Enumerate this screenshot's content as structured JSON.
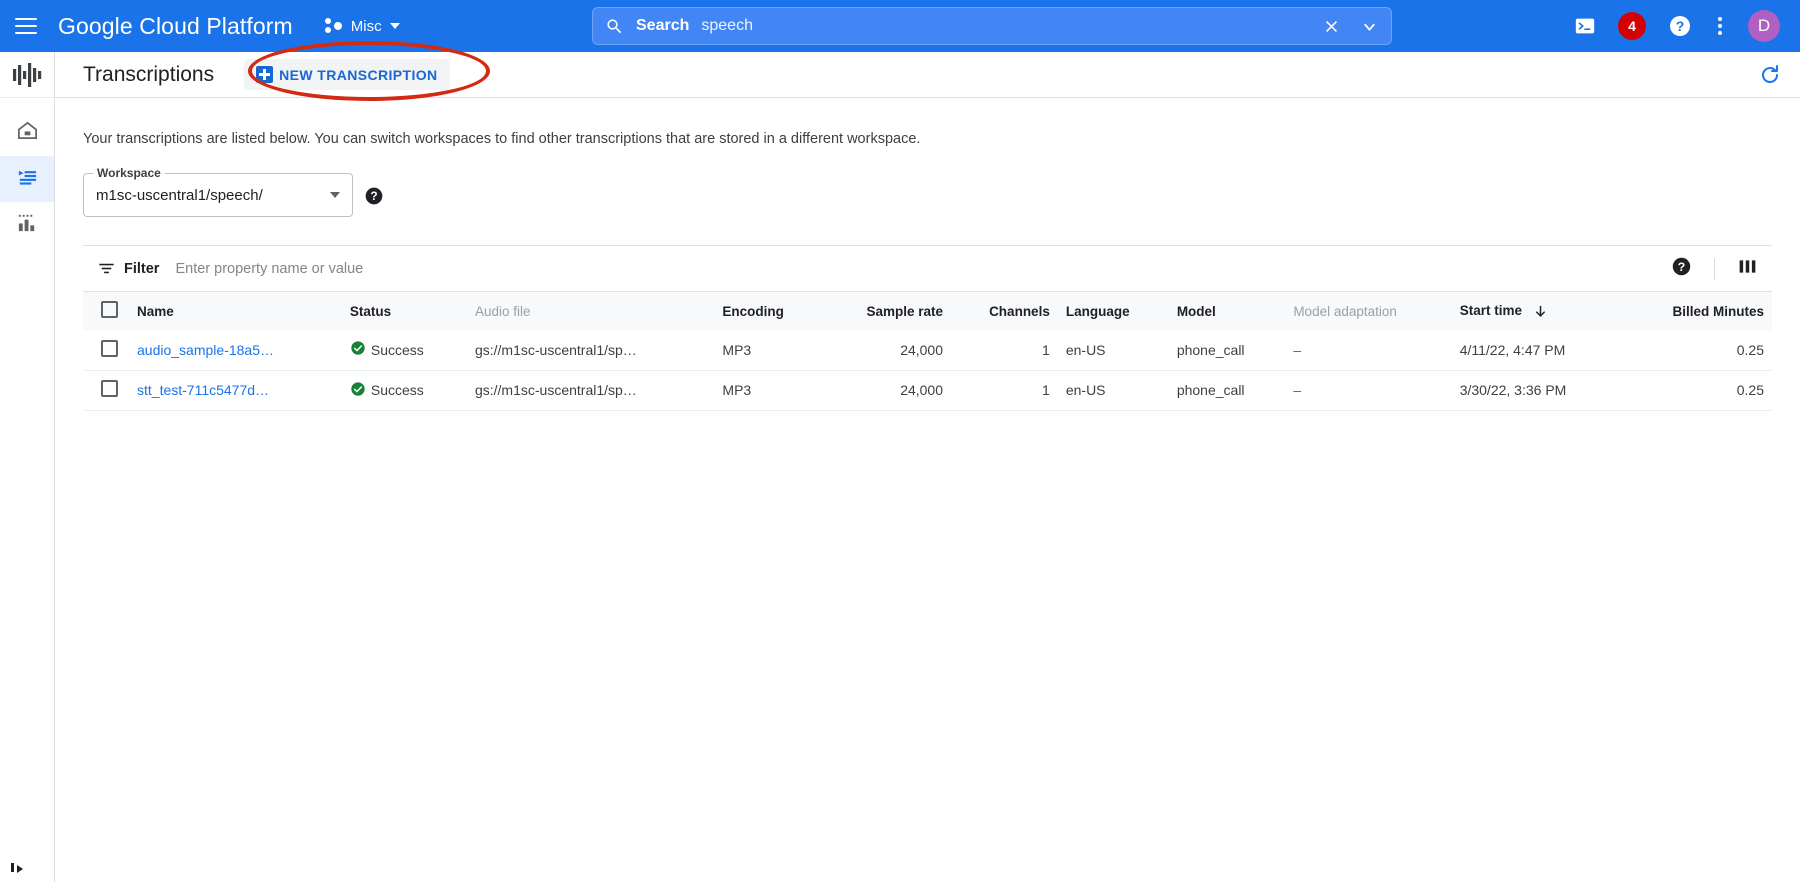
{
  "topbar": {
    "menu_icon": "hamburger-icon",
    "brand": "Google Cloud Platform",
    "project": "Misc",
    "search": {
      "label": "Search",
      "value": "speech",
      "clear_icon": "close-icon",
      "expand_icon": "chevron-down-icon"
    },
    "cloud_shell_icon": "terminal-icon",
    "notification_count": "4",
    "help_icon": "help-icon",
    "more_icon": "kebab-menu-icon",
    "avatar_initial": "D",
    "accent": "#1a73e8",
    "badge_color": "#d50000",
    "avatar_color": "#b05fc4"
  },
  "rail": {
    "logo_icon": "speech-waveform-icon",
    "items": [
      {
        "icon": "home-icon",
        "name": "home",
        "active": false
      },
      {
        "icon": "list-icon",
        "name": "transcriptions",
        "active": true
      },
      {
        "icon": "bar-chart-icon",
        "name": "analytics",
        "active": false
      }
    ]
  },
  "page": {
    "title": "Transcriptions",
    "new_button": {
      "label": "NEW TRANSCRIPTION",
      "icon": "plus-box-icon",
      "highlighted": true
    },
    "refresh_icon": "refresh-icon",
    "description": "Your transcriptions are listed below. You can switch workspaces to find other transcriptions that are stored in a different workspace.",
    "annotation_color": "#d32b13"
  },
  "workspace": {
    "legend": "Workspace",
    "value": "m1sc-uscentral1/speech/",
    "caret_icon": "chevron-down-icon",
    "help_icon": "help-icon"
  },
  "filter": {
    "icon": "filter-icon",
    "label": "Filter",
    "placeholder": "Enter property name or value",
    "help_icon": "help-icon",
    "columns_icon": "column-display-icon"
  },
  "table": {
    "select_all_icon": "checkbox-icon",
    "columns": [
      {
        "label": "Name",
        "muted": false,
        "align": "left"
      },
      {
        "label": "Status",
        "muted": false,
        "align": "left"
      },
      {
        "label": "Audio file",
        "muted": true,
        "align": "left"
      },
      {
        "label": "Encoding",
        "muted": false,
        "align": "left"
      },
      {
        "label": "Sample rate",
        "muted": false,
        "align": "right"
      },
      {
        "label": "Channels",
        "muted": false,
        "align": "right"
      },
      {
        "label": "Language",
        "muted": false,
        "align": "left"
      },
      {
        "label": "Model",
        "muted": false,
        "align": "left"
      },
      {
        "label": "Model adaptation",
        "muted": true,
        "align": "left"
      },
      {
        "label": "Start time",
        "muted": false,
        "align": "left",
        "sort": "desc",
        "sort_icon": "arrow-down-icon"
      },
      {
        "label": "Billed Minutes",
        "muted": false,
        "align": "right"
      }
    ],
    "rows": [
      {
        "name": "audio_sample-18a5…",
        "status": "Success",
        "status_icon": "check-circle-icon",
        "audio_file": "gs://m1sc-uscentral1/sp…",
        "encoding": "MP3",
        "sample_rate": "24,000",
        "channels": "1",
        "language": "en-US",
        "model": "phone_call",
        "model_adaptation": "–",
        "start_time": "4/11/22, 4:47 PM",
        "billed_minutes": "0.25"
      },
      {
        "name": "stt_test-711c5477d…",
        "status": "Success",
        "status_icon": "check-circle-icon",
        "audio_file": "gs://m1sc-uscentral1/sp…",
        "encoding": "MP3",
        "sample_rate": "24,000",
        "channels": "1",
        "language": "en-US",
        "model": "phone_call",
        "model_adaptation": "–",
        "start_time": "3/30/22, 3:36 PM",
        "billed_minutes": "0.25"
      }
    ],
    "status_color": "#188038"
  }
}
